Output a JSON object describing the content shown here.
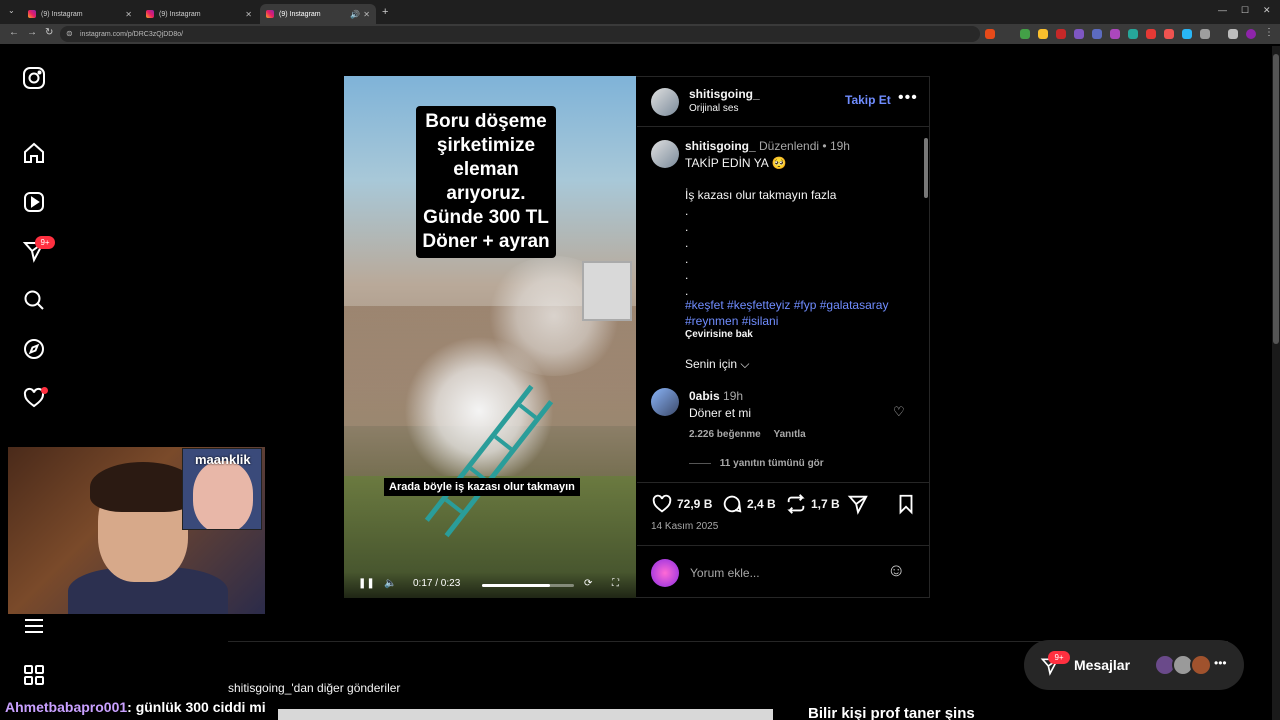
{
  "browser": {
    "tabs": [
      {
        "title": "(9) Instagram"
      },
      {
        "title": "(9) Instagram"
      },
      {
        "title": "(9) Instagram"
      }
    ],
    "url": "instagram.com/p/DRC3zQjDD8o/"
  },
  "sidebar": {
    "notification_badge": "9+"
  },
  "post": {
    "username": "shitisgoing_",
    "audio": "Orijinal ses",
    "follow_label": "Takip Et",
    "video": {
      "overlay_text": "Boru döşeme şirketimize eleman arıyoruz. Günde 300 TL Döner + ayran",
      "subtitle": "Arada böyle iş kazası olur takmayın",
      "time": "0:17 / 0:23",
      "progress": 0.74
    },
    "caption": {
      "username": "shitisgoing_",
      "edited": "Düzenlendi",
      "time": "19h",
      "line1": "TAKİP EDİN YA 🥺",
      "line2": "İş kazası olur takmayın fazla",
      "dots": ".\n.\n.\n.\n.\n.",
      "hashtags": "#keşfet #keşfetteyiz #fyp #galatasaray #reynmen #isilani",
      "translate": "Çevirisine bak",
      "for_you": "Senin için"
    },
    "comment": {
      "username": "0abis",
      "time": "19h",
      "text": "Döner et mi",
      "likes": "2.226 beğenme",
      "reply": "Yanıtla",
      "view_replies": "11 yanıtın tümünü gör"
    },
    "stats": {
      "likes": "72,9 B",
      "comments": "2,4 B",
      "reposts": "1,7 B"
    },
    "date": "14 Kasım 2025",
    "comment_placeholder": "Yorum ekle..."
  },
  "stream": {
    "cam_label": "maanklik",
    "chat_user": "Ahmetbabapro001",
    "chat_msg": ": günlük 300 ciddi mi"
  },
  "more_posts": "shitisgoing_'dan diğer gönderiler",
  "thumb_text": "Bilir kişi prof taner şins",
  "messages": {
    "label": "Mesajlar",
    "badge": "9+"
  },
  "colors": {
    "accent": "#708dff",
    "notification": "#ff3040",
    "background": "#000000"
  }
}
